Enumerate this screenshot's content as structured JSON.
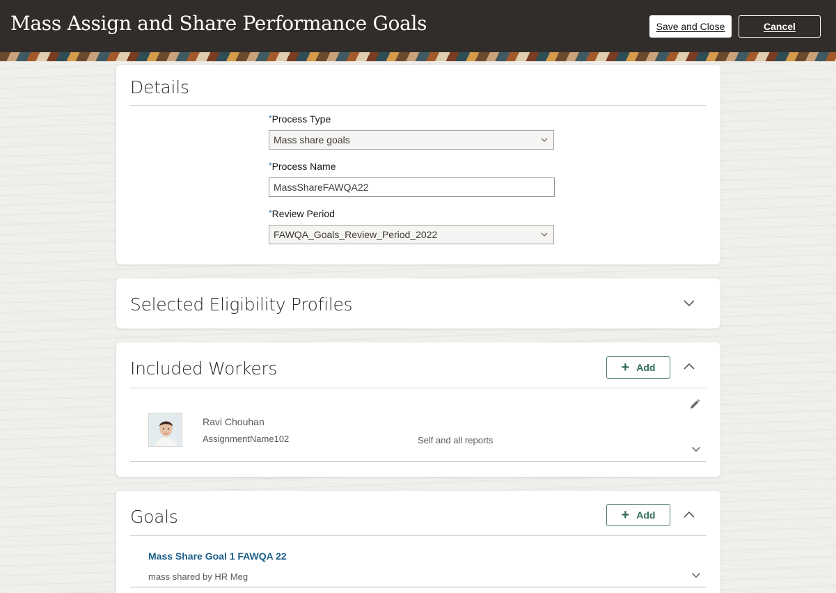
{
  "header": {
    "title": "Mass Assign and Share Performance Goals",
    "save_label": "Save and Close",
    "cancel_label": "Cancel"
  },
  "details": {
    "title": "Details",
    "process_type": {
      "label": "Process Type",
      "value": "Mass share goals"
    },
    "process_name": {
      "label": "Process Name",
      "value": "MassShareFAWQA22"
    },
    "review_period": {
      "label": "Review Period",
      "value": "FAWQA_Goals_Review_Period_2022"
    },
    "required_mark": "*"
  },
  "eligibility": {
    "title": "Selected Eligibility Profiles"
  },
  "workers": {
    "title": "Included Workers",
    "add_label": "Add",
    "items": [
      {
        "name": "Ravi Chouhan",
        "assignment": "AssignmentName102",
        "scope": "Self and all reports"
      }
    ]
  },
  "goals": {
    "title": "Goals",
    "add_label": "Add",
    "items": [
      {
        "name": "Mass Share Goal 1 FAWQA 22",
        "subtitle": "mass shared by HR Meg"
      }
    ]
  },
  "colors": {
    "header_bg": "#312d2a",
    "accent_green": "#2f6b57",
    "link_blue": "#1d5f8a",
    "required_blue": "#1a6f9e"
  },
  "icons": [
    "chevron-down-icon",
    "chevron-up-icon",
    "plus-icon",
    "pencil-icon",
    "avatar"
  ]
}
